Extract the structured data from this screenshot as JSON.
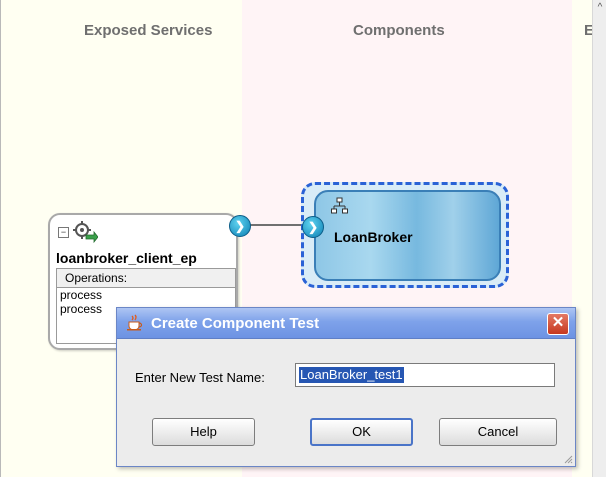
{
  "lanes": {
    "exposed_services": "Exposed Services",
    "components": "Components",
    "external_partial": "E"
  },
  "service": {
    "name": "loanbroker_client_ep",
    "operations_header": "Operations:",
    "operations": [
      "process",
      "process"
    ],
    "collapse_glyph": "⊟",
    "icon": "gear-icon"
  },
  "component": {
    "name": "LoanBroker",
    "icon": "bpel-process-icon"
  },
  "dialog": {
    "title": "Create Component Test",
    "field_label": "Enter New Test Name:",
    "field_value": "LoanBroker_test1",
    "help_label": "Help",
    "ok_label": "OK",
    "cancel_label": "Cancel",
    "close_glyph": "✕",
    "icon": "java-cup-icon"
  },
  "scrollbar": {
    "up_glyph": "^"
  },
  "colors": {
    "exposed_lane": "#fffff2",
    "components_lane": "#fff4f6",
    "selection": "#2a62d6",
    "titlebar": "#7ea2ea",
    "close": "#c6381f"
  }
}
